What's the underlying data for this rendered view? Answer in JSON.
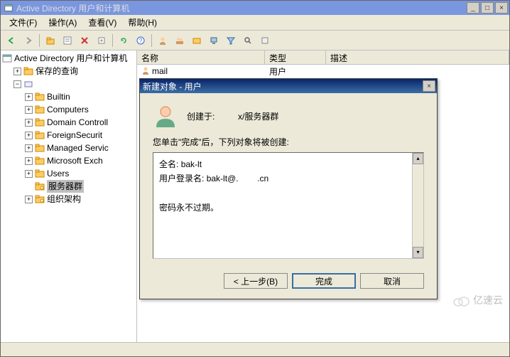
{
  "window": {
    "title": "Active Directory 用户和计算机",
    "minimize": "_",
    "maximize": "□",
    "close": "×"
  },
  "menus": {
    "file": "文件(F)",
    "action": "操作(A)",
    "view": "查看(V)",
    "help": "帮助(H)"
  },
  "toolbar_icons": {
    "back": "back-arrow",
    "forward": "forward-arrow",
    "up": "up-folder",
    "cut": "cut",
    "properties": "properties",
    "delete": "delete",
    "refresh": "refresh",
    "help": "help",
    "user": "user",
    "group": "group",
    "computer": "computer",
    "ou": "ou",
    "print": "print",
    "filter": "filter",
    "find": "find"
  },
  "tree": {
    "root": "Active Directory 用户和计算机",
    "saved_queries": "保存的查询",
    "builtin": "Builtin",
    "computers": "Computers",
    "domain_controllers": "Domain Controll",
    "foreign_security": "ForeignSecurit",
    "managed_service": "Managed Servic",
    "ms_exchange": "Microsoft Exch",
    "users": "Users",
    "server_group": "服务器群",
    "org_structure": "组织架构"
  },
  "list": {
    "col_name": "名称",
    "col_type": "类型",
    "col_desc": "描述",
    "rows": [
      {
        "name": "mail",
        "type": "用户",
        "desc": ""
      }
    ]
  },
  "dialog": {
    "title": "新建对象 - 用户",
    "close": "×",
    "created_in_label": "创建于:",
    "created_in_path": "x/服务器群",
    "instruction": "您单击\"完成\"后，下列对象将被创建:",
    "summary_fullname_label": "全名:",
    "summary_fullname_value": "bak-lt",
    "summary_logon_label": "用户登录名:",
    "summary_logon_value": "bak-lt@.        .cn",
    "summary_password": "密码永不过期。",
    "btn_back": "< 上一步(B)",
    "btn_finish": "完成",
    "btn_cancel": "取消"
  },
  "watermark": {
    "text": "亿速云"
  }
}
